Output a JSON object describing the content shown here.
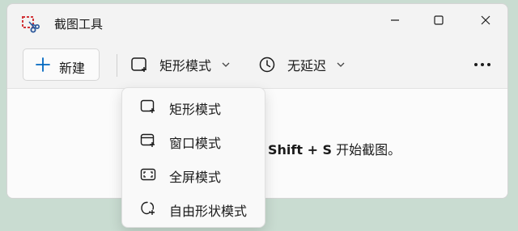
{
  "window": {
    "title": "截图工具",
    "controls": [
      "minimize-icon",
      "maximize-icon",
      "close-icon"
    ]
  },
  "toolbar": {
    "new_label": "新建",
    "mode_label": "矩形模式",
    "delay_label": "无延迟"
  },
  "content": {
    "hint_bold": "Shift + S",
    "hint_rest": " 开始截图。"
  },
  "mode_menu": {
    "items": [
      {
        "label": "矩形模式",
        "icon": "rectangle-mode-icon"
      },
      {
        "label": "窗口模式",
        "icon": "window-mode-icon"
      },
      {
        "label": "全屏模式",
        "icon": "fullscreen-mode-icon"
      },
      {
        "label": "自由形状模式",
        "icon": "freeform-mode-icon"
      }
    ]
  },
  "colors": {
    "accent": "#0067c0",
    "app_icon_red": "#d13438"
  }
}
